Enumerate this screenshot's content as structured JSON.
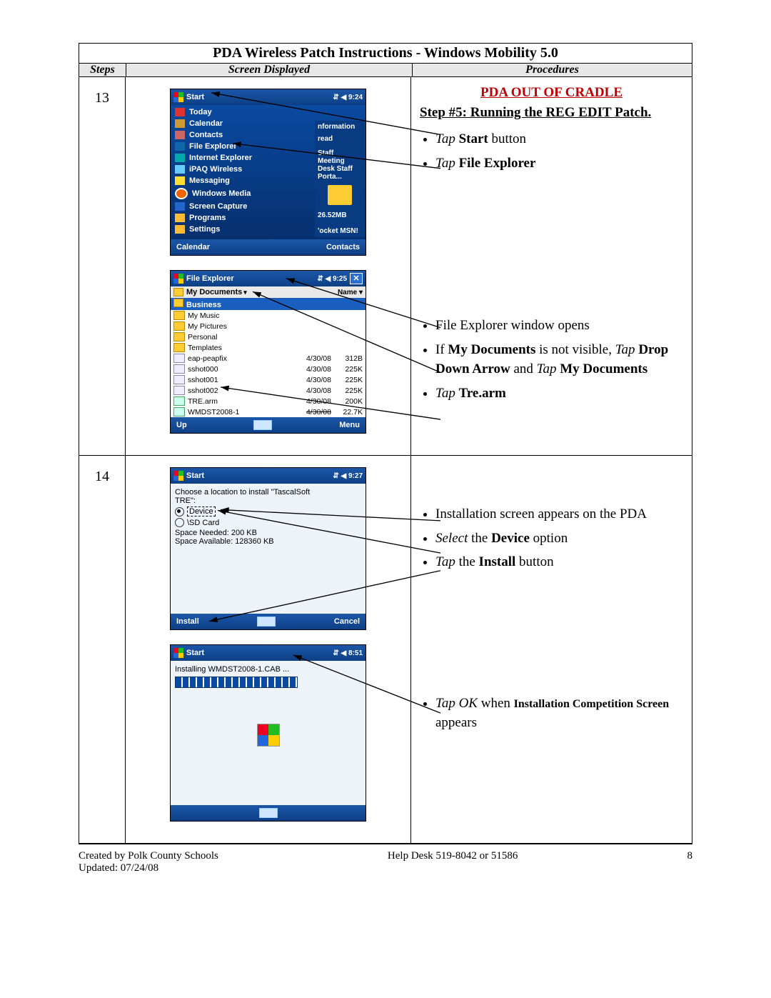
{
  "doc": {
    "title": "PDA Wireless Patch Instructions - Windows Mobility 5.0",
    "colSteps": "Steps",
    "colScreen": "Screen Displayed",
    "colProc": "Procedures"
  },
  "row13": {
    "num": "13",
    "proc": {
      "warn": "PDA OUT OF CRADLE",
      "stepTitle": "Step #5: Running the REG EDIT Patch.",
      "b1_tap": "Tap ",
      "b1_bold": "Start",
      "b1_rest": " button",
      "b2_tap": "Tap ",
      "b2_bold": "File Explorer",
      "b3": "File Explorer window opens",
      "b4_a": "If ",
      "b4_b": "My Documents",
      "b4_c": " is not visible, ",
      "b4_d": "Tap",
      "b4_e": " Drop Down Arrow",
      "b4_f": " and ",
      "b4_g": "Tap",
      "b4_h": " My Documents",
      "b5_tap": "Tap ",
      "b5_bold": "Tre.arm"
    },
    "startMenu": {
      "title": "Start",
      "clock": "⇵ ◀ 9:24",
      "items": [
        "Today",
        "Calendar",
        "Contacts",
        "File Explorer",
        "Internet Explorer",
        "iPAQ Wireless",
        "Messaging",
        "Windows Media",
        "Screen Capture",
        "Programs",
        "Settings"
      ],
      "right": [
        "nformation",
        "read",
        "Staff Meeting",
        "Desk Staff Porta...",
        "26.52MB",
        "'ocket MSN!"
      ],
      "softL": "Calendar",
      "softR": "Contacts"
    },
    "fe": {
      "title": "File Explorer",
      "clock": "⇵ ◀ 9:25",
      "close": "✕",
      "sub": "My Documents",
      "nameCol": "Name",
      "hl": "Business",
      "folders": [
        "My Music",
        "My Pictures",
        "Personal",
        "Templates"
      ],
      "files": [
        {
          "n": "eap-peapfix",
          "d": "4/30/08",
          "s": "312B"
        },
        {
          "n": "sshot000",
          "d": "4/30/08",
          "s": "225K"
        },
        {
          "n": "sshot001",
          "d": "4/30/08",
          "s": "225K"
        },
        {
          "n": "sshot002",
          "d": "4/30/08",
          "s": "225K"
        },
        {
          "n": "TRE.arm",
          "d": "4/30/08",
          "s": "200K"
        },
        {
          "n": "WMDST2008-1",
          "d": "4/30/08",
          "s": "22.7K"
        }
      ],
      "softL": "Up",
      "softR": "Menu"
    }
  },
  "row14": {
    "num": "14",
    "proc": {
      "b1": "Installation screen appears on the PDA",
      "b2_a": "Select",
      "b2_b": " the ",
      "b2_c": "Device",
      "b2_d": "  option",
      "b3_a": "Tap",
      "b3_b": " the ",
      "b3_c": "Install",
      "b3_d": " button",
      "b4_a": "Tap OK",
      "b4_b": " when ",
      "b4_c": "Installation Competition Screen",
      "b4_d": " appears"
    },
    "install": {
      "title": "Start",
      "clock": "⇵ ◀ 9:27",
      "prompt1": "Choose a location to install \"TascalSoft",
      "prompt2": "TRE\":",
      "optDevice": "Device",
      "optSD": "\\SD Card",
      "need": "Space Needed: 200 KB",
      "avail": "Space Available: 128360 KB",
      "softL": "Install",
      "softR": "Cancel"
    },
    "progress": {
      "title": "Start",
      "clock": "⇵ ◀ 8:51",
      "msg": "Installing WMDST2008-1.CAB ..."
    }
  },
  "footer": {
    "left1": "Created by Polk County Schools",
    "left2": "Updated: 07/24/08",
    "mid": "Help Desk 519-8042 or 51586",
    "right": "8"
  }
}
